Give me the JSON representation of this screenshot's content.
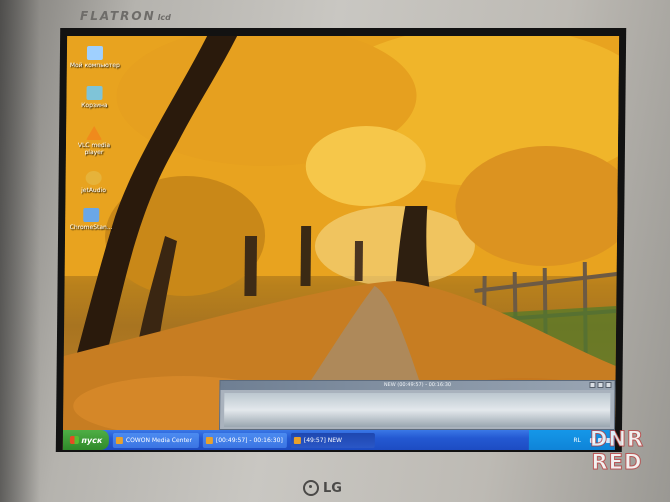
{
  "monitor": {
    "brand_top": "FLATRON",
    "brand_top_sub": "lcd",
    "brand_bottom": "LG"
  },
  "watermark": {
    "line1": "DNR",
    "line2": "RED"
  },
  "desktop_icons": [
    {
      "label": "Мой компьютер",
      "color": "#9fd0ff"
    },
    {
      "label": "Корзина",
      "color": "#7fc4d8"
    },
    {
      "label": "VLC media player",
      "color": "#f08a1c"
    },
    {
      "label": "jetAudio",
      "color": "#e6b33a"
    },
    {
      "label": "ChromeStan...",
      "color": "#6aa7e6"
    }
  ],
  "taskbar": {
    "start_label": "пуск",
    "buttons": [
      {
        "label": "COWON Media Center",
        "active": false
      },
      {
        "label": "[00:49:57] - 00:16:30]",
        "active": false
      },
      {
        "label": "[49:57] NEW",
        "active": true
      }
    ],
    "language": "RL"
  },
  "player": {
    "title": "NEW (00:49:57) - 00:16:30"
  },
  "colors": {
    "foliage": "#e9a822",
    "taskbar": "#2459d2",
    "start_button": "#3a9a33"
  }
}
